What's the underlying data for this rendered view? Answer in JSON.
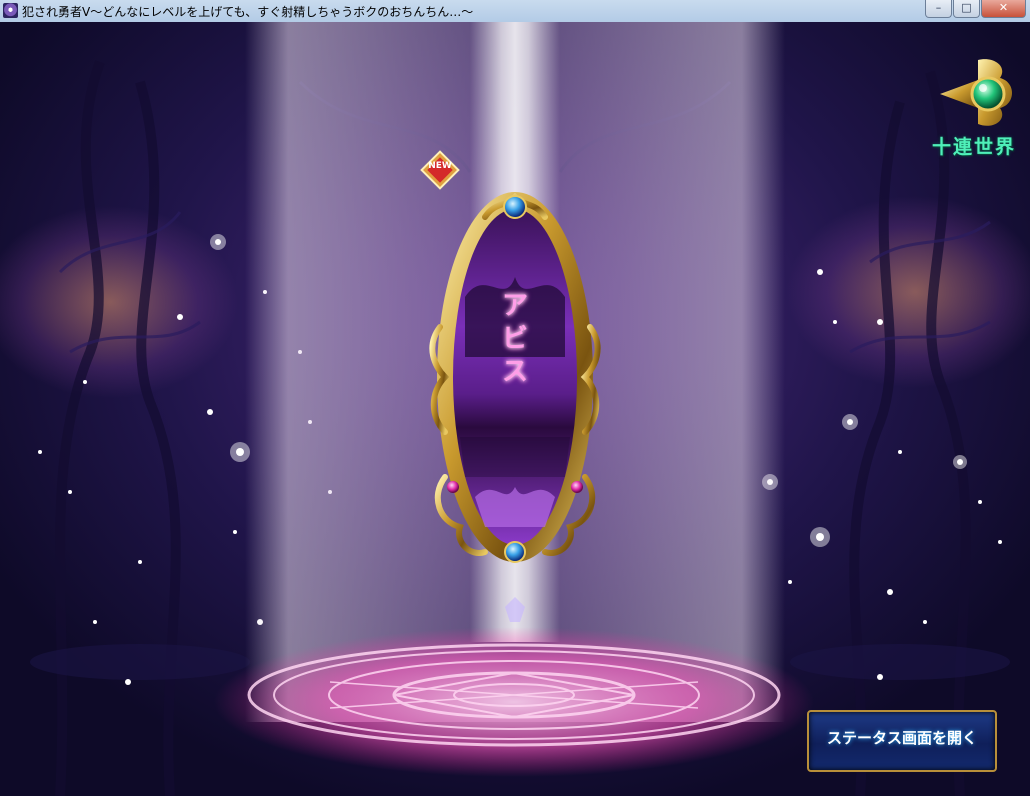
{
  "window": {
    "title": "犯され勇者Ⅴ～どんなにレベルを上げても、すぐ射精しちゃうボクのおちんちん…～",
    "minimize_glyph": "–",
    "maximize_glyph": "□",
    "close_glyph": "✕"
  },
  "scene": {
    "mirror_label": "アビス",
    "new_badge": "NEW",
    "emblem_icon": "green-orb-ornament-icon",
    "emblem_label": "十連世界",
    "status_button_label": "ステータス画面を開く"
  },
  "colors": {
    "mirror_text": "#ff9ee8",
    "emblem_text": "#4ff0b9",
    "status_button_bg": "#1e3a86"
  }
}
